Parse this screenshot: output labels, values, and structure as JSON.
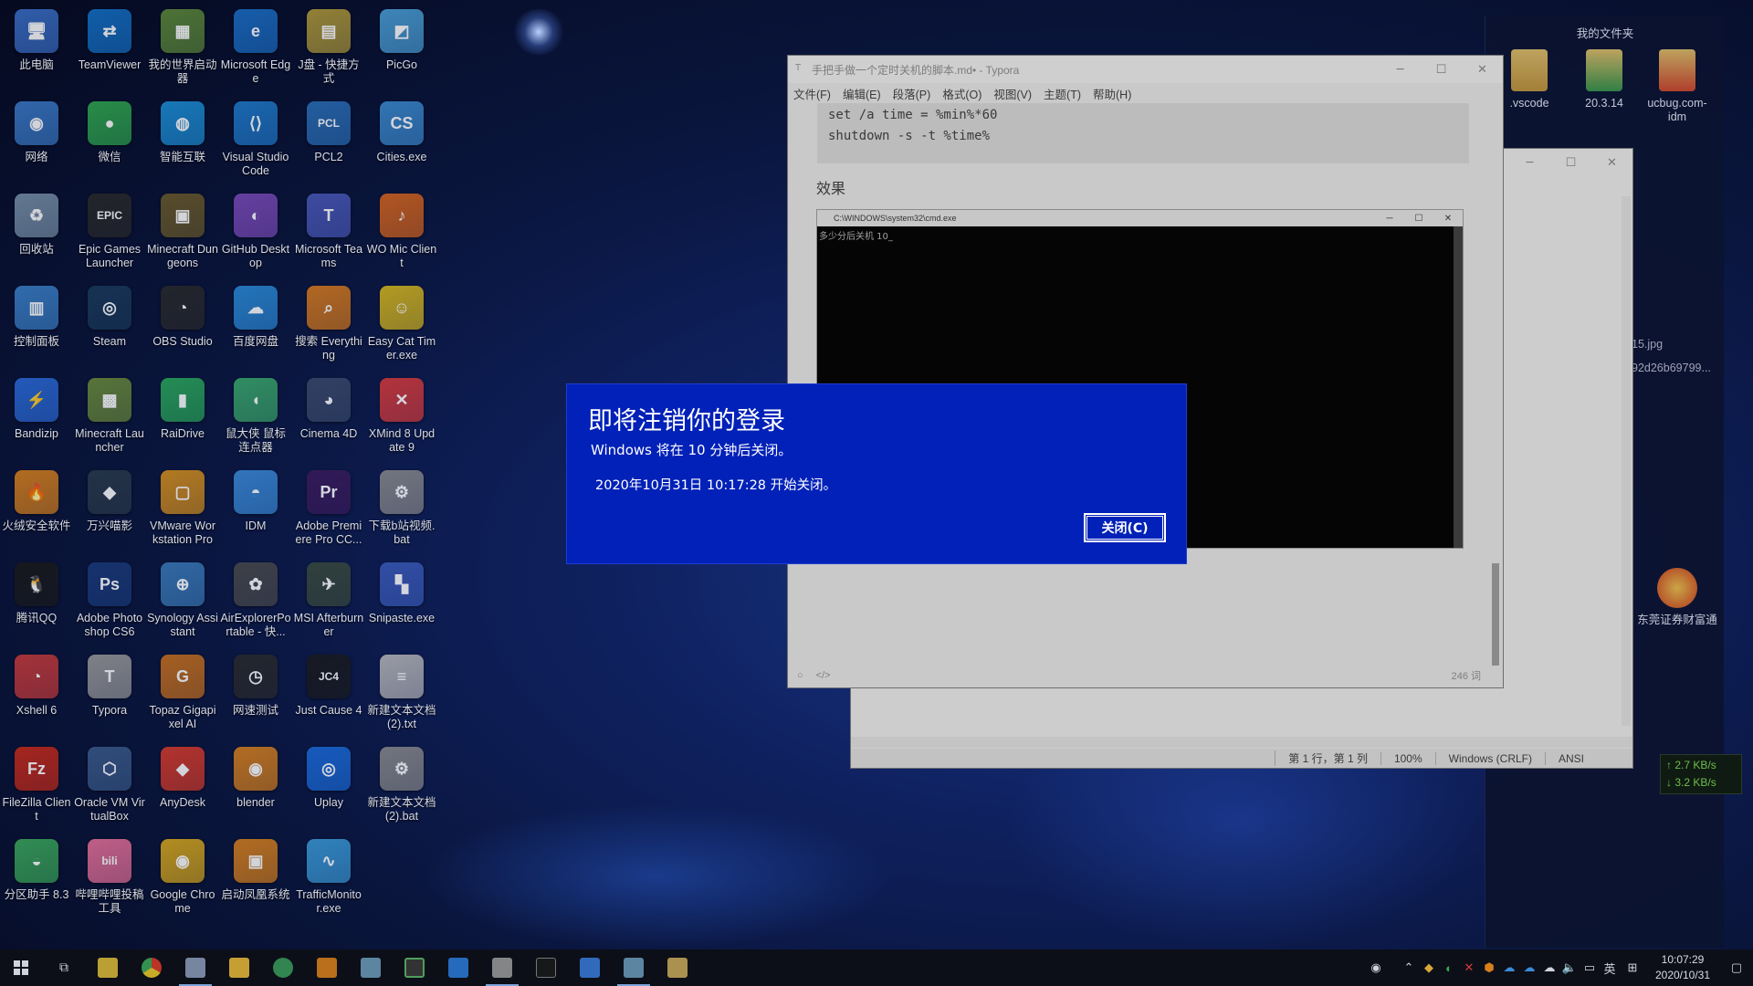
{
  "desktop_icons": [
    {
      "label": "此电脑",
      "color": "#3a6fc8",
      "glyph": "🖥"
    },
    {
      "label": "TeamViewer",
      "color": "#1471c8",
      "glyph": "⇄"
    },
    {
      "label": "我的世界启动器",
      "color": "#5d8a3a",
      "glyph": "▦"
    },
    {
      "label": "Microsoft Edge",
      "color": "#1b6fc8",
      "glyph": "e"
    },
    {
      "label": "J盘 - 快捷方式",
      "color": "#b09a3a",
      "glyph": "▤"
    },
    {
      "label": "PicGo",
      "color": "#4aa0d8",
      "glyph": "◩"
    },
    {
      "label": "网络",
      "color": "#3a7ac8",
      "glyph": "◉"
    },
    {
      "label": "微信",
      "color": "#2fa84f",
      "glyph": "●"
    },
    {
      "label": "智能互联",
      "color": "#1c8fd8",
      "glyph": "◍"
    },
    {
      "label": "Visual Studio Code",
      "color": "#1f7acc",
      "glyph": "⟨⟩"
    },
    {
      "label": "PCL2",
      "color": "#2a6fb8",
      "glyph": "PCL"
    },
    {
      "label": "Cities.exe",
      "color": "#3b8ad0",
      "glyph": "CS"
    },
    {
      "label": "回收站",
      "color": "#7890a8",
      "glyph": "♻"
    },
    {
      "label": "Epic Games Launcher",
      "color": "#2a2a2a",
      "glyph": "EPIC"
    },
    {
      "label": "Minecraft Dungeons",
      "color": "#6a5a2a",
      "glyph": "▣"
    },
    {
      "label": "GitHub Desktop",
      "color": "#7a4ab8",
      "glyph": "◐"
    },
    {
      "label": "Microsoft Teams",
      "color": "#4a58b8",
      "glyph": "T"
    },
    {
      "label": "WO Mic Client",
      "color": "#d8641c",
      "glyph": "♪"
    },
    {
      "label": "控制面板",
      "color": "#3a80c8",
      "glyph": "▥"
    },
    {
      "label": "Steam",
      "color": "#1a3a5a",
      "glyph": "◎"
    },
    {
      "label": "OBS Studio",
      "color": "#2a2a2a",
      "glyph": "◔"
    },
    {
      "label": "百度网盘",
      "color": "#2a8ad8",
      "glyph": "☁"
    },
    {
      "label": "搜索 Everything",
      "color": "#d87a1c",
      "glyph": "⌕"
    },
    {
      "label": "Easy Cat Timer.exe",
      "color": "#d8b81c",
      "glyph": "☺"
    },
    {
      "label": "Bandizip",
      "color": "#2a6ad8",
      "glyph": "⚡"
    },
    {
      "label": "Minecraft Launcher",
      "color": "#6a8a3a",
      "glyph": "▩"
    },
    {
      "label": "RaiDrive",
      "color": "#2aa85a",
      "glyph": "▮"
    },
    {
      "label": "鼠大侠 鼠标连点器",
      "color": "#3aa86a",
      "glyph": "◖"
    },
    {
      "label": "Cinema 4D",
      "color": "#3a4a6a",
      "glyph": "◕"
    },
    {
      "label": "XMind 8 Update 9",
      "color": "#d83a3a",
      "glyph": "✕"
    },
    {
      "label": "火绒安全软件",
      "color": "#d8801c",
      "glyph": "🔥"
    },
    {
      "label": "万兴喵影",
      "color": "#2a3a4a",
      "glyph": "◆"
    },
    {
      "label": "VMware Workstation Pro",
      "color": "#d8901c",
      "glyph": "▢"
    },
    {
      "label": "IDM",
      "color": "#3a8ad8",
      "glyph": "◓"
    },
    {
      "label": "Adobe Premiere Pro CC...",
      "color": "#3a1a5a",
      "glyph": "Pr"
    },
    {
      "label": "下载b站视频.bat",
      "color": "#8a8a8a",
      "glyph": "⚙"
    },
    {
      "label": "腾讯QQ",
      "color": "#1a1a1a",
      "glyph": "🐧"
    },
    {
      "label": "Adobe Photoshop CS6",
      "color": "#1a3a7a",
      "glyph": "Ps"
    },
    {
      "label": "Synology Assistant",
      "color": "#3a7ab8",
      "glyph": "⊕"
    },
    {
      "label": "AirExplorerPortable - 快...",
      "color": "#4a4a4a",
      "glyph": "✿"
    },
    {
      "label": "MSI Afterburner",
      "color": "#3a4a3a",
      "glyph": "✈"
    },
    {
      "label": "Snipaste.exe",
      "color": "#3a5ab8",
      "glyph": "▚"
    },
    {
      "label": "Xshell 6",
      "color": "#c83a3a",
      "glyph": "◔"
    },
    {
      "label": "Typora",
      "color": "#9a9a9a",
      "glyph": "T"
    },
    {
      "label": "Topaz Gigapixel AI",
      "color": "#c8701c",
      "glyph": "G"
    },
    {
      "label": "网速测试",
      "color": "#2a2a2a",
      "glyph": "◷"
    },
    {
      "label": "Just Cause 4",
      "color": "#1a1a1a",
      "glyph": "JC4"
    },
    {
      "label": "新建文本文档 (2).txt",
      "color": "#b8b8b8",
      "glyph": "≡"
    },
    {
      "label": "FileZilla Client",
      "color": "#c82a1a",
      "glyph": "Fz"
    },
    {
      "label": "Oracle VM VirtualBox",
      "color": "#3a5a8a",
      "glyph": "⬡"
    },
    {
      "label": "AnyDesk",
      "color": "#d83a2a",
      "glyph": "◆"
    },
    {
      "label": "blender",
      "color": "#d8801c",
      "glyph": "◉"
    },
    {
      "label": "Uplay",
      "color": "#1a6ad8",
      "glyph": "◎"
    },
    {
      "label": "新建文本文档 (2).bat",
      "color": "#8a8a8a",
      "glyph": "⚙"
    },
    {
      "label": "分区助手 8.3",
      "color": "#3aa85a",
      "glyph": "◒"
    },
    {
      "label": "哔哩哔哩投稿工具",
      "color": "#e8709a",
      "glyph": "bili"
    },
    {
      "label": "Google Chrome",
      "color": "#d8a81c",
      "glyph": "◉"
    },
    {
      "label": "启动凤凰系统",
      "color": "#d8801c",
      "glyph": "▣"
    },
    {
      "label": "TrafficMonitor.exe",
      "color": "#3a9ad8",
      "glyph": "∿"
    }
  ],
  "typora": {
    "title": "手把手做一个定时关机的脚本.md• - Typora",
    "menu": [
      "文件(F)",
      "编辑(E)",
      "段落(P)",
      "格式(O)",
      "视图(V)",
      "主题(T)",
      "帮助(H)"
    ],
    "code_lines": [
      "set /a time = %min%*60",
      "shutdown -s -t %time%"
    ],
    "heading": "效果",
    "cmd_title": "C:\\WINDOWS\\system32\\cmd.exe",
    "cmd_text": "多少分后关机 10_",
    "word_count": "246 词"
  },
  "notepad": {
    "status": [
      "第 1 行，第 1 列",
      "100%",
      "Windows (CRLF)",
      "ANSI"
    ]
  },
  "right_panel": {
    "title": "我的文件夹",
    "files": [
      ".vscode",
      "20.3.14",
      "ucbug.com-idm"
    ],
    "partial_names": [
      "15.jpg",
      "92d26b69799..."
    ],
    "app_label": "东莞证券财富通"
  },
  "net_speed": {
    "up": "↑ 2.7 KB/s",
    "down": "↓ 3.2 KB/s"
  },
  "dialog": {
    "title": "即将注销你的登录",
    "message": "Windows 将在 10 分钟后关闭。",
    "time": "2020年10月31日 10:17:28 开始关闭。",
    "close_label": "关闭(C)"
  },
  "taskbar": {
    "time": "10:07:29",
    "date": "2020/10/31",
    "ime": "英"
  }
}
